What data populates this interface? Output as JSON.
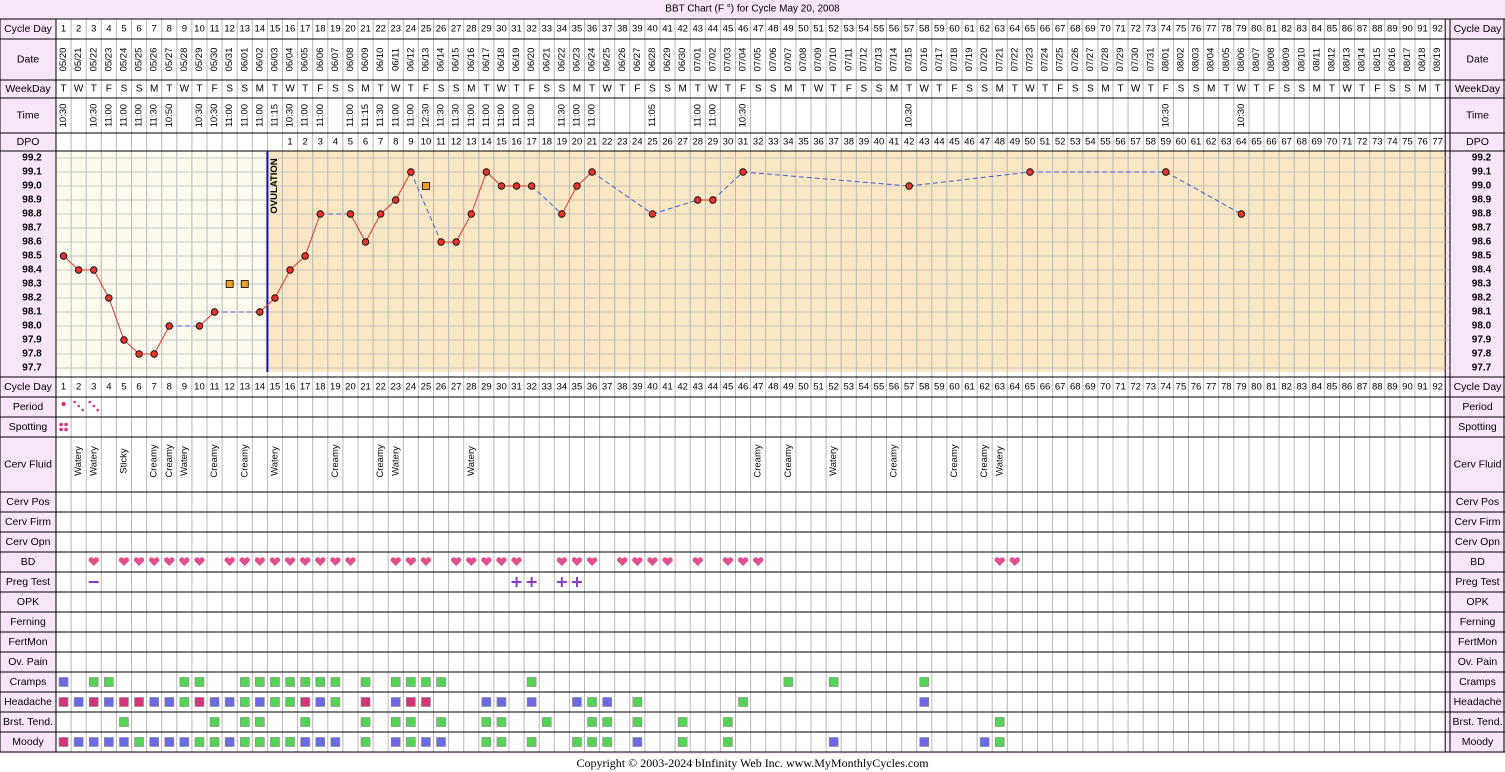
{
  "title": "BBT Chart (F °) for Cycle May 20, 2008",
  "footer": "Copyright © 2003-2024 bInfinity Web Inc.     www.MyMonthlyCycles.com",
  "colors": {
    "outer_bg": "#f7e6f7",
    "border": "#b58bb5",
    "preov_bg": "#fcfaec",
    "postov_bg": "#fae8c5",
    "grid": "#b8b8b8",
    "temp_line": "#e5342e",
    "coverline_dash": "#4460d8",
    "ovulation_line": "#1010c8",
    "point_fill": "#e5342e",
    "heart": "#e0508e",
    "plus": "#8a3cc8",
    "green": "#54d454",
    "blue": "#6a6ae6",
    "magenta": "#d4347c",
    "orange_marker": "#f0a020"
  },
  "row_labels": {
    "cycle_day": "Cycle Day",
    "date": "Date",
    "weekday": "WeekDay",
    "time": "Time",
    "dpo": "DPO",
    "period": "Period",
    "spotting": "Spotting",
    "cerv_fluid": "Cerv Fluid",
    "cerv_pos": "Cerv Pos",
    "cerv_firm": "Cerv Firm",
    "cerv_opn": "Cerv Opn",
    "bd": "BD",
    "preg_test": "Preg Test",
    "opk": "OPK",
    "ferning": "Ferning",
    "fertmon": "FertMon",
    "ov_pain": "Ov. Pain",
    "cramps": "Cramps",
    "headache": "Headache",
    "brst_tend": "Brst. Tend.",
    "moody": "Moody"
  },
  "chart_data": {
    "type": "line",
    "title": "BBT Chart (F °) for Cycle May 20, 2008",
    "xlabel": "Cycle Day",
    "ylabel": "",
    "ylim": [
      97.7,
      99.2
    ],
    "y_ticks": [
      "99.2",
      "99.1",
      "99.0",
      "98.9",
      "98.8",
      "98.7",
      "98.6",
      "98.5",
      "98.4",
      "98.3",
      "98.2",
      "98.1",
      "98.0",
      "97.9",
      "97.8",
      "97.7"
    ],
    "ovulation_label": "OVULATION",
    "ovulation_day": 15,
    "num_days": 92,
    "dates": [
      "05/20",
      "05/21",
      "05/22",
      "05/23",
      "05/24",
      "05/25",
      "05/26",
      "05/27",
      "05/28",
      "05/29",
      "05/30",
      "05/31",
      "06/01",
      "06/02",
      "06/03",
      "06/04",
      "06/05",
      "06/06",
      "06/07",
      "06/08",
      "06/09",
      "06/10",
      "06/11",
      "06/12",
      "06/13",
      "06/14",
      "06/15",
      "06/16",
      "06/17",
      "06/18",
      "06/19",
      "06/20",
      "06/21",
      "06/22",
      "06/23",
      "06/24",
      "06/25",
      "06/26",
      "06/27",
      "06/28",
      "06/29",
      "06/30",
      "07/01",
      "07/02",
      "07/03",
      "07/04",
      "07/05",
      "07/06",
      "07/07",
      "07/08",
      "07/09",
      "07/10",
      "07/11",
      "07/12",
      "07/13",
      "07/14",
      "07/15",
      "07/16",
      "07/17",
      "07/18",
      "07/19",
      "07/20",
      "07/21",
      "07/22",
      "07/23",
      "07/24",
      "07/25",
      "07/26",
      "07/27",
      "07/28",
      "07/29",
      "07/30",
      "07/31",
      "08/01",
      "08/02",
      "08/03",
      "08/04",
      "08/05",
      "08/06",
      "08/07",
      "08/08",
      "08/09",
      "08/10",
      "08/11",
      "08/12",
      "08/13",
      "08/14",
      "08/15",
      "08/16",
      "08/17",
      "08/18",
      "08/19"
    ],
    "weekdays": [
      "T",
      "W",
      "T",
      "F",
      "S",
      "S",
      "M",
      "T",
      "W",
      "T",
      "F",
      "S",
      "S",
      "M",
      "T",
      "W",
      "T",
      "F",
      "S",
      "S",
      "M",
      "T",
      "W",
      "T",
      "F",
      "S",
      "S",
      "M",
      "T",
      "W",
      "T",
      "F",
      "S",
      "S",
      "M",
      "T",
      "W",
      "T",
      "F",
      "S",
      "S",
      "M",
      "T",
      "W",
      "T",
      "F",
      "S",
      "S",
      "M",
      "T",
      "W",
      "T",
      "F",
      "S",
      "S",
      "M",
      "T",
      "W",
      "T",
      "F",
      "S",
      "S",
      "M",
      "T",
      "W",
      "T",
      "F",
      "S",
      "S",
      "M",
      "T",
      "W",
      "T",
      "F",
      "S",
      "S",
      "M",
      "T",
      "W",
      "T",
      "F",
      "S",
      "S",
      "M",
      "T",
      "W",
      "T",
      "F",
      "S",
      "S",
      "M",
      "T"
    ],
    "times": [
      "10:30",
      "",
      "10:30",
      "11:00",
      "11:00",
      "11:00",
      "11:30",
      "10:50",
      "",
      "10:30",
      "10:30",
      "11:00",
      "11:00",
      "11:00",
      "11:15",
      "10:30",
      "11:00",
      "11:00",
      "",
      "11:00",
      "11:15",
      "11:30",
      "11:00",
      "11:00",
      "12:30",
      "11:30",
      "11:30",
      "11:00",
      "11:00",
      "11:00",
      "11:00",
      "11:00",
      "",
      "11:30",
      "11:00",
      "11:00",
      "",
      "",
      "",
      "11:05",
      "",
      "",
      "11:00",
      "11:00",
      "",
      "10:30",
      "",
      "",
      "",
      "",
      "",
      "",
      "",
      "",
      "",
      "",
      "10:30",
      "",
      "",
      "",
      "",
      "",
      "",
      "",
      "",
      "",
      "",
      "",
      "",
      "",
      "",
      "",
      "",
      "10:30",
      "",
      "",
      "",
      "",
      "10:30",
      "",
      "",
      "",
      "",
      "",
      "",
      "",
      "",
      "",
      "",
      "",
      "",
      ""
    ],
    "dpo": [
      "",
      "",
      "",
      "",
      "",
      "",
      "",
      "",
      "",
      "",
      "",
      "",
      "",
      "",
      "",
      "1",
      "2",
      "3",
      "4",
      "5",
      "6",
      "7",
      "8",
      "9",
      "10",
      "11",
      "12",
      "13",
      "14",
      "15",
      "16",
      "17",
      "18",
      "19",
      "20",
      "21",
      "22",
      "23",
      "24",
      "25",
      "26",
      "27",
      "28",
      "29",
      "30",
      "31",
      "32",
      "33",
      "34",
      "35",
      "36",
      "37",
      "38",
      "39",
      "40",
      "41",
      "42",
      "43",
      "44",
      "45",
      "46",
      "47",
      "48",
      "49",
      "50",
      "51",
      "52",
      "53",
      "54",
      "55",
      "56",
      "57",
      "58",
      "59",
      "60",
      "61",
      "62",
      "63",
      "64",
      "65",
      "66",
      "67",
      "68",
      "69",
      "70",
      "71",
      "72",
      "73",
      "74",
      "75",
      "76",
      "77"
    ],
    "temperatures": [
      [
        1,
        98.5
      ],
      [
        2,
        98.4
      ],
      [
        3,
        98.4
      ],
      [
        4,
        98.2
      ],
      [
        5,
        97.9
      ],
      [
        6,
        97.8
      ],
      [
        7,
        97.8
      ],
      [
        8,
        98.0
      ],
      [
        10,
        98.0
      ],
      [
        11,
        98.1
      ],
      [
        14,
        98.1
      ],
      [
        15,
        98.2
      ],
      [
        16,
        98.4
      ],
      [
        17,
        98.5
      ],
      [
        18,
        98.8
      ],
      [
        20,
        98.8
      ],
      [
        21,
        98.6
      ],
      [
        22,
        98.8
      ],
      [
        23,
        98.9
      ],
      [
        24,
        99.1
      ],
      [
        26,
        98.6
      ],
      [
        27,
        98.6
      ],
      [
        28,
        98.8
      ],
      [
        29,
        99.1
      ],
      [
        30,
        99.0
      ],
      [
        31,
        99.0
      ],
      [
        32,
        99.0
      ],
      [
        34,
        98.8
      ],
      [
        35,
        99.0
      ],
      [
        36,
        99.1
      ],
      [
        40,
        98.8
      ],
      [
        43,
        98.9
      ],
      [
        44,
        98.9
      ],
      [
        46,
        99.1
      ],
      [
        57,
        99.0
      ],
      [
        65,
        99.1
      ],
      [
        74,
        99.1
      ],
      [
        79,
        98.8
      ]
    ],
    "discarded_temps": [
      [
        12,
        98.3
      ],
      [
        13,
        98.3
      ],
      [
        25,
        99.0
      ]
    ],
    "cerv_fluid": {
      "2": "Watery",
      "3": "Watery",
      "5": "Sticky",
      "7": "Creamy",
      "8": "Creamy",
      "9": "Watery",
      "11": "Creamy",
      "13": "Creamy",
      "15": "Watery",
      "19": "Creamy",
      "22": "Creamy",
      "23": "Watery",
      "28": "Watery",
      "47": "Creamy",
      "49": "Creamy",
      "52": "Watery",
      "56": "Creamy",
      "60": "Creamy",
      "62": "Creamy",
      "63": "Watery"
    },
    "period": {
      "1": "dot",
      "2": "light",
      "3": "light"
    },
    "spotting": [
      1
    ],
    "bd": [
      3,
      5,
      6,
      7,
      8,
      9,
      10,
      12,
      13,
      14,
      15,
      16,
      17,
      18,
      19,
      20,
      23,
      24,
      25,
      27,
      28,
      29,
      30,
      31,
      34,
      35,
      36,
      38,
      39,
      40,
      41,
      43,
      45,
      46,
      47,
      63,
      64
    ],
    "preg_test": {
      "3": "negative",
      "31": "positive",
      "32": "positive",
      "34": "positive",
      "35": "positive"
    },
    "cramps": {
      "1": "blue",
      "3": "green",
      "4": "green",
      "9": "green",
      "10": "green",
      "13": "green",
      "14": "green",
      "15": "green",
      "16": "green",
      "17": "green",
      "18": "green",
      "19": "green",
      "21": "green",
      "23": "green",
      "24": "green",
      "25": "green",
      "26": "green",
      "32": "green",
      "49": "green",
      "52": "green",
      "58": "green"
    },
    "headache": {
      "1": "magenta",
      "2": "blue",
      "3": "magenta",
      "4": "blue",
      "5": "magenta",
      "6": "magenta",
      "7": "blue",
      "8": "blue",
      "9": "green",
      "10": "magenta",
      "11": "blue",
      "12": "blue",
      "13": "green",
      "14": "blue",
      "15": "green",
      "16": "green",
      "17": "magenta",
      "18": "blue",
      "19": "green",
      "21": "magenta",
      "23": "blue",
      "24": "magenta",
      "25": "magenta",
      "29": "blue",
      "30": "blue",
      "32": "blue",
      "35": "blue",
      "36": "green",
      "37": "blue",
      "39": "green",
      "46": "green",
      "58": "blue"
    },
    "brst_tend": {
      "5": "green",
      "11": "green",
      "13": "green",
      "14": "green",
      "17": "green",
      "21": "green",
      "23": "green",
      "24": "green",
      "26": "green",
      "29": "green",
      "30": "green",
      "33": "green",
      "36": "green",
      "37": "green",
      "39": "green",
      "42": "green",
      "45": "green",
      "63": "green"
    },
    "moody": {
      "1": "magenta",
      "2": "blue",
      "3": "blue",
      "4": "blue",
      "5": "blue",
      "6": "green",
      "7": "blue",
      "8": "blue",
      "9": "blue",
      "10": "green",
      "11": "green",
      "12": "blue",
      "13": "green",
      "14": "green",
      "15": "green",
      "16": "green",
      "17": "blue",
      "18": "blue",
      "19": "blue",
      "21": "green",
      "23": "blue",
      "24": "green",
      "25": "blue",
      "26": "blue",
      "29": "green",
      "30": "green",
      "32": "green",
      "35": "green",
      "36": "green",
      "37": "green",
      "39": "blue",
      "42": "green",
      "45": "green",
      "52": "blue",
      "58": "blue",
      "62": "blue",
      "63": "green"
    }
  }
}
